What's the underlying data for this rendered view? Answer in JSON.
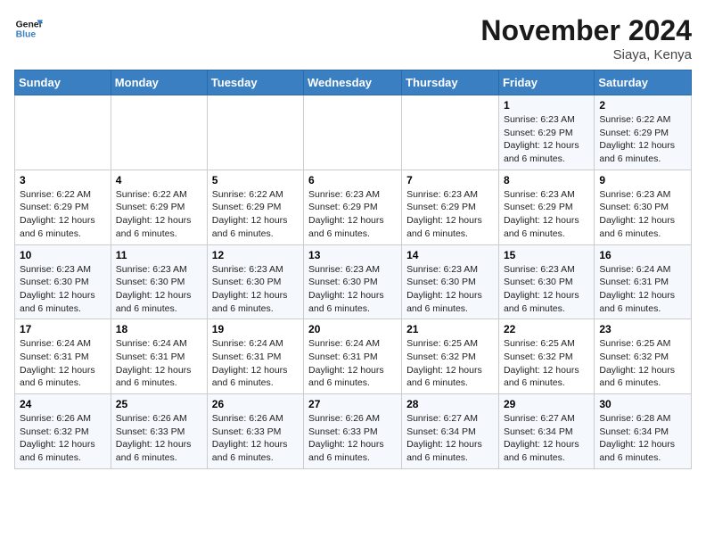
{
  "logo": {
    "line1": "General",
    "line2": "Blue"
  },
  "title": "November 2024",
  "location": "Siaya, Kenya",
  "days_of_week": [
    "Sunday",
    "Monday",
    "Tuesday",
    "Wednesday",
    "Thursday",
    "Friday",
    "Saturday"
  ],
  "weeks": [
    [
      {
        "day": "",
        "info": ""
      },
      {
        "day": "",
        "info": ""
      },
      {
        "day": "",
        "info": ""
      },
      {
        "day": "",
        "info": ""
      },
      {
        "day": "",
        "info": ""
      },
      {
        "day": "1",
        "info": "Sunrise: 6:23 AM\nSunset: 6:29 PM\nDaylight: 12 hours and 6 minutes."
      },
      {
        "day": "2",
        "info": "Sunrise: 6:22 AM\nSunset: 6:29 PM\nDaylight: 12 hours and 6 minutes."
      }
    ],
    [
      {
        "day": "3",
        "info": "Sunrise: 6:22 AM\nSunset: 6:29 PM\nDaylight: 12 hours and 6 minutes."
      },
      {
        "day": "4",
        "info": "Sunrise: 6:22 AM\nSunset: 6:29 PM\nDaylight: 12 hours and 6 minutes."
      },
      {
        "day": "5",
        "info": "Sunrise: 6:22 AM\nSunset: 6:29 PM\nDaylight: 12 hours and 6 minutes."
      },
      {
        "day": "6",
        "info": "Sunrise: 6:23 AM\nSunset: 6:29 PM\nDaylight: 12 hours and 6 minutes."
      },
      {
        "day": "7",
        "info": "Sunrise: 6:23 AM\nSunset: 6:29 PM\nDaylight: 12 hours and 6 minutes."
      },
      {
        "day": "8",
        "info": "Sunrise: 6:23 AM\nSunset: 6:29 PM\nDaylight: 12 hours and 6 minutes."
      },
      {
        "day": "9",
        "info": "Sunrise: 6:23 AM\nSunset: 6:30 PM\nDaylight: 12 hours and 6 minutes."
      }
    ],
    [
      {
        "day": "10",
        "info": "Sunrise: 6:23 AM\nSunset: 6:30 PM\nDaylight: 12 hours and 6 minutes."
      },
      {
        "day": "11",
        "info": "Sunrise: 6:23 AM\nSunset: 6:30 PM\nDaylight: 12 hours and 6 minutes."
      },
      {
        "day": "12",
        "info": "Sunrise: 6:23 AM\nSunset: 6:30 PM\nDaylight: 12 hours and 6 minutes."
      },
      {
        "day": "13",
        "info": "Sunrise: 6:23 AM\nSunset: 6:30 PM\nDaylight: 12 hours and 6 minutes."
      },
      {
        "day": "14",
        "info": "Sunrise: 6:23 AM\nSunset: 6:30 PM\nDaylight: 12 hours and 6 minutes."
      },
      {
        "day": "15",
        "info": "Sunrise: 6:23 AM\nSunset: 6:30 PM\nDaylight: 12 hours and 6 minutes."
      },
      {
        "day": "16",
        "info": "Sunrise: 6:24 AM\nSunset: 6:31 PM\nDaylight: 12 hours and 6 minutes."
      }
    ],
    [
      {
        "day": "17",
        "info": "Sunrise: 6:24 AM\nSunset: 6:31 PM\nDaylight: 12 hours and 6 minutes."
      },
      {
        "day": "18",
        "info": "Sunrise: 6:24 AM\nSunset: 6:31 PM\nDaylight: 12 hours and 6 minutes."
      },
      {
        "day": "19",
        "info": "Sunrise: 6:24 AM\nSunset: 6:31 PM\nDaylight: 12 hours and 6 minutes."
      },
      {
        "day": "20",
        "info": "Sunrise: 6:24 AM\nSunset: 6:31 PM\nDaylight: 12 hours and 6 minutes."
      },
      {
        "day": "21",
        "info": "Sunrise: 6:25 AM\nSunset: 6:32 PM\nDaylight: 12 hours and 6 minutes."
      },
      {
        "day": "22",
        "info": "Sunrise: 6:25 AM\nSunset: 6:32 PM\nDaylight: 12 hours and 6 minutes."
      },
      {
        "day": "23",
        "info": "Sunrise: 6:25 AM\nSunset: 6:32 PM\nDaylight: 12 hours and 6 minutes."
      }
    ],
    [
      {
        "day": "24",
        "info": "Sunrise: 6:26 AM\nSunset: 6:32 PM\nDaylight: 12 hours and 6 minutes."
      },
      {
        "day": "25",
        "info": "Sunrise: 6:26 AM\nSunset: 6:33 PM\nDaylight: 12 hours and 6 minutes."
      },
      {
        "day": "26",
        "info": "Sunrise: 6:26 AM\nSunset: 6:33 PM\nDaylight: 12 hours and 6 minutes."
      },
      {
        "day": "27",
        "info": "Sunrise: 6:26 AM\nSunset: 6:33 PM\nDaylight: 12 hours and 6 minutes."
      },
      {
        "day": "28",
        "info": "Sunrise: 6:27 AM\nSunset: 6:34 PM\nDaylight: 12 hours and 6 minutes."
      },
      {
        "day": "29",
        "info": "Sunrise: 6:27 AM\nSunset: 6:34 PM\nDaylight: 12 hours and 6 minutes."
      },
      {
        "day": "30",
        "info": "Sunrise: 6:28 AM\nSunset: 6:34 PM\nDaylight: 12 hours and 6 minutes."
      }
    ]
  ]
}
